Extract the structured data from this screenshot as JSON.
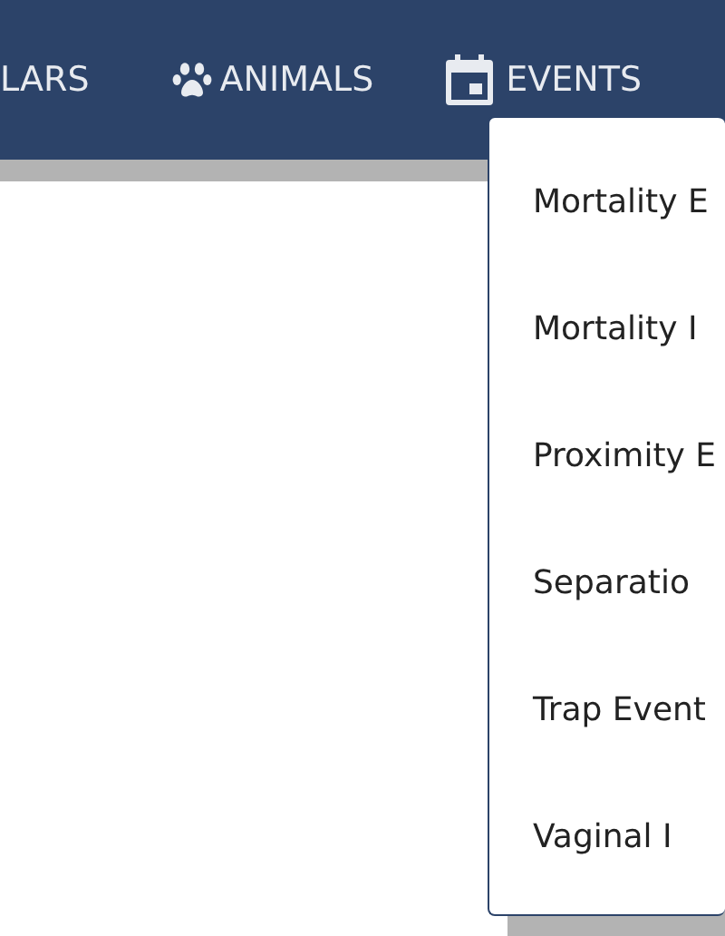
{
  "nav": [
    {
      "label": "LARS"
    },
    {
      "label": "ANIMALS"
    },
    {
      "label": "EVENTS"
    }
  ],
  "events_menu": {
    "items": [
      {
        "label": "Mortality E"
      },
      {
        "label": "Mortality I"
      },
      {
        "label": "Proximity E"
      },
      {
        "label": "Separatio"
      },
      {
        "label": "Trap Event"
      },
      {
        "label": "Vaginal I"
      }
    ]
  }
}
